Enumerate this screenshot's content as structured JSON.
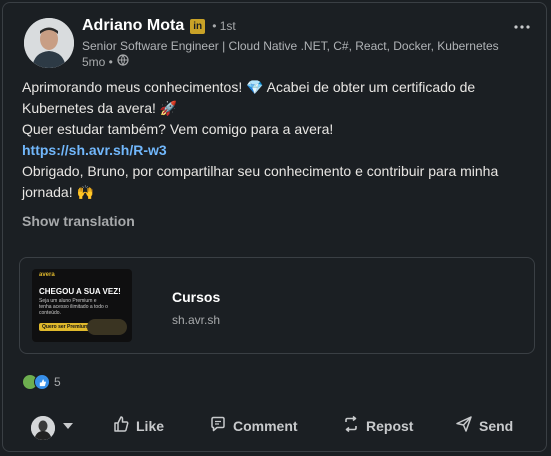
{
  "author": {
    "name": "Adriano Mota",
    "badge": "in",
    "degree": "• 1st",
    "headline": "Senior Software Engineer | Cloud Native .NET, C#, React, Docker, Kubernetes",
    "time": "5mo •",
    "visibility_icon": "globe-icon"
  },
  "post": {
    "line1": "Aprimorando meus conhecimentos! 💎 Acabei de obter um certificado de Kubernetes da avera! 🚀",
    "line2": "Quer estudar também? Vem comigo para a avera!",
    "link": "https://sh.avr.sh/R-w3",
    "line3": "Obrigado, Bruno, por compartilhar seu conhecimento e contribuir para minha jornada! 🙌",
    "translate": "Show translation"
  },
  "link_preview": {
    "thumb_brand": "avera",
    "thumb_headline": "CHEGOU A SUA VEZ!",
    "thumb_sub": "Seja um aluno Premium e tenha acesso ilimitado a todo o conteúdo.",
    "thumb_cta": "Quero ser Premium",
    "title": "Cursos",
    "domain": "sh.avr.sh"
  },
  "social": {
    "reaction_count": "5",
    "reaction_icons": [
      "celebrate-icon",
      "like-icon"
    ]
  },
  "actions": {
    "like": "Like",
    "comment": "Comment",
    "repost": "Repost",
    "send": "Send"
  },
  "colors": {
    "background": "#1b1f23",
    "link": "#71b7fb",
    "badge": "#c9a227",
    "like_blue": "#378fe9",
    "celebrate_green": "#6dae4f"
  }
}
